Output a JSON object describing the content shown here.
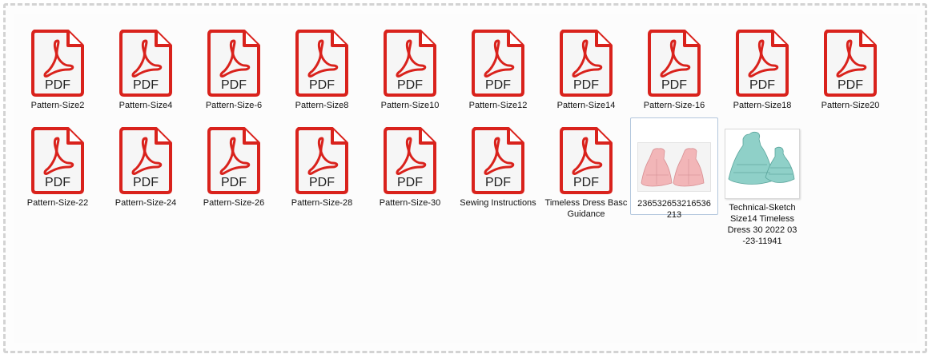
{
  "colors": {
    "pdf_red": "#d9221c",
    "pdf_bg": "#f6f6f6",
    "selection_border": "#b3c7dd"
  },
  "icons": {
    "pdf": "pdf-file-icon",
    "image": "image-thumbnail"
  },
  "pdf_badge": "PDF",
  "files": [
    {
      "name": "Pattern-Size2",
      "type": "pdf"
    },
    {
      "name": "Pattern-Size4",
      "type": "pdf"
    },
    {
      "name": "Pattern-Size-6",
      "type": "pdf"
    },
    {
      "name": "Pattern-Size8",
      "type": "pdf"
    },
    {
      "name": "Pattern-Size10",
      "type": "pdf"
    },
    {
      "name": "Pattern-Size12",
      "type": "pdf"
    },
    {
      "name": "Pattern-Size14",
      "type": "pdf"
    },
    {
      "name": "Pattern-Size-16",
      "type": "pdf"
    },
    {
      "name": "Pattern-Size18",
      "type": "pdf"
    },
    {
      "name": "Pattern-Size20",
      "type": "pdf"
    },
    {
      "name": "Pattern-Size-22",
      "type": "pdf"
    },
    {
      "name": "Pattern-Size-24",
      "type": "pdf"
    },
    {
      "name": "Pattern-Size-26",
      "type": "pdf"
    },
    {
      "name": "Pattern-Size-28",
      "type": "pdf"
    },
    {
      "name": "Pattern-Size-30",
      "type": "pdf"
    },
    {
      "name": "Sewing Instructions",
      "type": "pdf"
    },
    {
      "name": "Timeless Dress Basc Guidance",
      "type": "pdf"
    },
    {
      "name": "236532653216536 213",
      "type": "image-pink",
      "selected": true
    },
    {
      "name": "Technical-Sketch Size14  Timeless Dress 30  2022  03 -23-11941",
      "type": "image-teal"
    }
  ]
}
